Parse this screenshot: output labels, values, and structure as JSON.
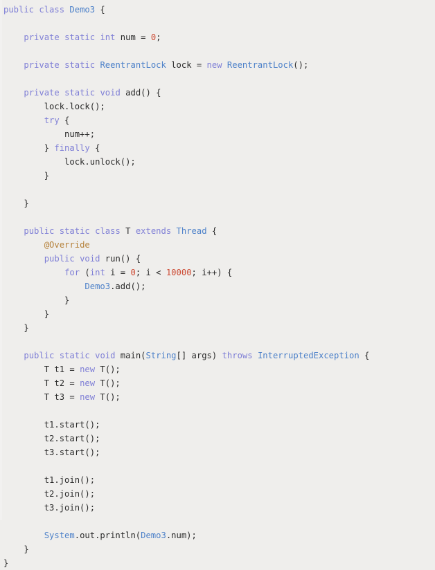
{
  "editor": {
    "language": "java",
    "file_name": "Demo3.java",
    "background_color": "#efeeec",
    "colors": {
      "keyword": "#7f7fd6",
      "type": "#4d81c9",
      "number": "#cc4a33",
      "annotation": "#b5813a",
      "plain": "#2b2b2b"
    }
  },
  "code": {
    "lines": [
      [
        {
          "t": "public",
          "c": "kw"
        },
        {
          "t": " ",
          "c": "pl"
        },
        {
          "t": "class",
          "c": "kw"
        },
        {
          "t": " ",
          "c": "pl"
        },
        {
          "t": "Demo3",
          "c": "typ"
        },
        {
          "t": " {",
          "c": "pl"
        }
      ],
      [],
      [
        {
          "t": "    ",
          "c": "pl"
        },
        {
          "t": "private",
          "c": "kw"
        },
        {
          "t": " ",
          "c": "pl"
        },
        {
          "t": "static",
          "c": "kw"
        },
        {
          "t": " ",
          "c": "pl"
        },
        {
          "t": "int",
          "c": "kw"
        },
        {
          "t": " num = ",
          "c": "pl"
        },
        {
          "t": "0",
          "c": "num"
        },
        {
          "t": ";",
          "c": "pl"
        }
      ],
      [],
      [
        {
          "t": "    ",
          "c": "pl"
        },
        {
          "t": "private",
          "c": "kw"
        },
        {
          "t": " ",
          "c": "pl"
        },
        {
          "t": "static",
          "c": "kw"
        },
        {
          "t": " ",
          "c": "pl"
        },
        {
          "t": "ReentrantLock",
          "c": "typ"
        },
        {
          "t": " lock = ",
          "c": "pl"
        },
        {
          "t": "new",
          "c": "kw"
        },
        {
          "t": " ",
          "c": "pl"
        },
        {
          "t": "ReentrantLock",
          "c": "typ"
        },
        {
          "t": "();",
          "c": "pl"
        }
      ],
      [],
      [
        {
          "t": "    ",
          "c": "pl"
        },
        {
          "t": "private",
          "c": "kw"
        },
        {
          "t": " ",
          "c": "pl"
        },
        {
          "t": "static",
          "c": "kw"
        },
        {
          "t": " ",
          "c": "pl"
        },
        {
          "t": "void",
          "c": "kw"
        },
        {
          "t": " add() {",
          "c": "pl"
        }
      ],
      [
        {
          "t": "        lock.lock();",
          "c": "pl"
        }
      ],
      [
        {
          "t": "        ",
          "c": "pl"
        },
        {
          "t": "try",
          "c": "kw"
        },
        {
          "t": " {",
          "c": "pl"
        }
      ],
      [
        {
          "t": "            num++;",
          "c": "pl"
        }
      ],
      [
        {
          "t": "        } ",
          "c": "pl"
        },
        {
          "t": "finally",
          "c": "kw"
        },
        {
          "t": " {",
          "c": "pl"
        }
      ],
      [
        {
          "t": "            lock.unlock();",
          "c": "pl"
        }
      ],
      [
        {
          "t": "        }",
          "c": "pl"
        }
      ],
      [],
      [
        {
          "t": "    }",
          "c": "pl"
        }
      ],
      [],
      [
        {
          "t": "    ",
          "c": "pl"
        },
        {
          "t": "public",
          "c": "kw"
        },
        {
          "t": " ",
          "c": "pl"
        },
        {
          "t": "static",
          "c": "kw"
        },
        {
          "t": " ",
          "c": "pl"
        },
        {
          "t": "class",
          "c": "kw"
        },
        {
          "t": " T ",
          "c": "pl"
        },
        {
          "t": "extends",
          "c": "kw"
        },
        {
          "t": " ",
          "c": "pl"
        },
        {
          "t": "Thread",
          "c": "typ"
        },
        {
          "t": " {",
          "c": "pl"
        }
      ],
      [
        {
          "t": "        ",
          "c": "pl"
        },
        {
          "t": "@Override",
          "c": "ann"
        }
      ],
      [
        {
          "t": "        ",
          "c": "pl"
        },
        {
          "t": "public",
          "c": "kw"
        },
        {
          "t": " ",
          "c": "pl"
        },
        {
          "t": "void",
          "c": "kw"
        },
        {
          "t": " run() {",
          "c": "pl"
        }
      ],
      [
        {
          "t": "            ",
          "c": "pl"
        },
        {
          "t": "for",
          "c": "kw"
        },
        {
          "t": " (",
          "c": "pl"
        },
        {
          "t": "int",
          "c": "kw"
        },
        {
          "t": " i = ",
          "c": "pl"
        },
        {
          "t": "0",
          "c": "num"
        },
        {
          "t": "; i < ",
          "c": "pl"
        },
        {
          "t": "10000",
          "c": "num"
        },
        {
          "t": "; i++) {",
          "c": "pl"
        }
      ],
      [
        {
          "t": "                ",
          "c": "pl"
        },
        {
          "t": "Demo3",
          "c": "typ"
        },
        {
          "t": ".add();",
          "c": "pl"
        }
      ],
      [
        {
          "t": "            }",
          "c": "pl"
        }
      ],
      [
        {
          "t": "        }",
          "c": "pl"
        }
      ],
      [
        {
          "t": "    }",
          "c": "pl"
        }
      ],
      [],
      [
        {
          "t": "    ",
          "c": "pl"
        },
        {
          "t": "public",
          "c": "kw"
        },
        {
          "t": " ",
          "c": "pl"
        },
        {
          "t": "static",
          "c": "kw"
        },
        {
          "t": " ",
          "c": "pl"
        },
        {
          "t": "void",
          "c": "kw"
        },
        {
          "t": " main(",
          "c": "pl"
        },
        {
          "t": "String",
          "c": "typ"
        },
        {
          "t": "[] args) ",
          "c": "pl"
        },
        {
          "t": "throws",
          "c": "kw"
        },
        {
          "t": " ",
          "c": "pl"
        },
        {
          "t": "InterruptedException",
          "c": "typ"
        },
        {
          "t": " {",
          "c": "pl"
        }
      ],
      [
        {
          "t": "        T t1 = ",
          "c": "pl"
        },
        {
          "t": "new",
          "c": "kw"
        },
        {
          "t": " T();",
          "c": "pl"
        }
      ],
      [
        {
          "t": "        T t2 = ",
          "c": "pl"
        },
        {
          "t": "new",
          "c": "kw"
        },
        {
          "t": " T();",
          "c": "pl"
        }
      ],
      [
        {
          "t": "        T t3 = ",
          "c": "pl"
        },
        {
          "t": "new",
          "c": "kw"
        },
        {
          "t": " T();",
          "c": "pl"
        }
      ],
      [],
      [
        {
          "t": "        t1.start();",
          "c": "pl"
        }
      ],
      [
        {
          "t": "        t2.start();",
          "c": "pl"
        }
      ],
      [
        {
          "t": "        t3.start();",
          "c": "pl"
        }
      ],
      [],
      [
        {
          "t": "        t1.join();",
          "c": "pl"
        }
      ],
      [
        {
          "t": "        t2.join();",
          "c": "pl"
        }
      ],
      [
        {
          "t": "        t3.join();",
          "c": "pl"
        }
      ],
      [],
      [
        {
          "t": "        ",
          "c": "pl"
        },
        {
          "t": "System",
          "c": "typ"
        },
        {
          "t": ".out.println(",
          "c": "pl"
        },
        {
          "t": "Demo3",
          "c": "typ"
        },
        {
          "t": ".num);",
          "c": "pl"
        }
      ],
      [
        {
          "t": "    }",
          "c": "pl"
        }
      ],
      [
        {
          "t": "}",
          "c": "pl"
        }
      ]
    ],
    "plain_text": "public class Demo3 {\n\n    private static int num = 0;\n\n    private static ReentrantLock lock = new ReentrantLock();\n\n    private static void add() {\n        lock.lock();\n        try {\n            num++;\n        } finally {\n            lock.unlock();\n        }\n\n    }\n\n    public static class T extends Thread {\n        @Override\n        public void run() {\n            for (int i = 0; i < 10000; i++) {\n                Demo3.add();\n            }\n        }\n    }\n\n    public static void main(String[] args) throws InterruptedException {\n        T t1 = new T();\n        T t2 = new T();\n        T t3 = new T();\n\n        t1.start();\n        t2.start();\n        t3.start();\n\n        t1.join();\n        t2.join();\n        t3.join();\n\n        System.out.println(Demo3.num);\n    }\n}"
  }
}
